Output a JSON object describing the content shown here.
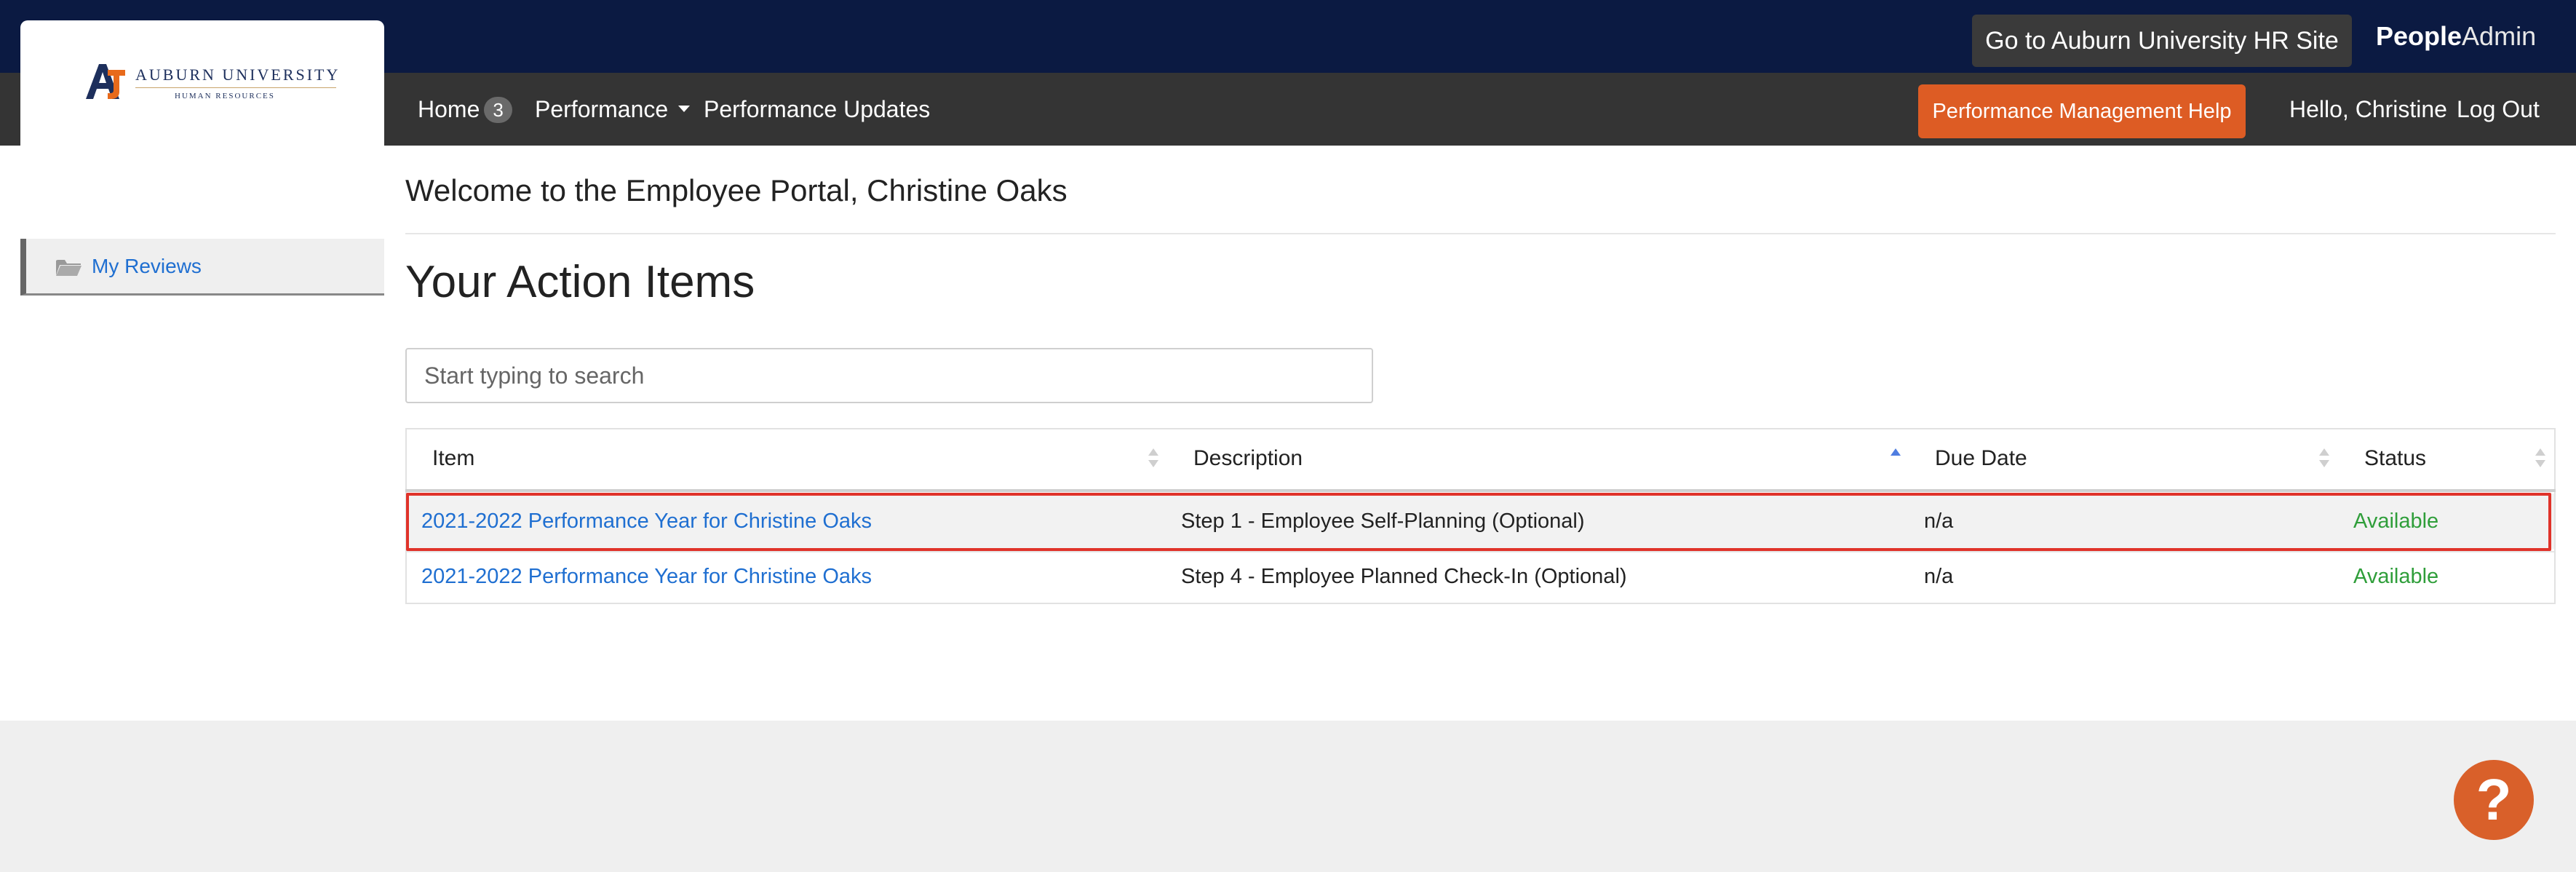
{
  "header": {
    "hr_site_button": "Go to Auburn University HR Site",
    "brand_bold": "People",
    "brand_light": "Admin"
  },
  "logo": {
    "main": "AUBURN UNIVERSITY",
    "sub": "HUMAN RESOURCES"
  },
  "nav": {
    "home": "Home",
    "home_badge": "3",
    "performance": "Performance",
    "performance_updates": "Performance Updates",
    "help_button": "Performance Management Help",
    "greeting": "Hello, Christine",
    "logout": "Log Out"
  },
  "sidebar": {
    "items": [
      {
        "label": "My Reviews",
        "icon": "folder-open-icon"
      }
    ]
  },
  "main": {
    "welcome": "Welcome to the Employee Portal, Christine Oaks",
    "title": "Your Action Items",
    "search_placeholder": "Start typing to search",
    "table": {
      "columns": [
        "Item",
        "Description",
        "Due Date",
        "Status"
      ],
      "sorted_column": "Description",
      "rows": [
        {
          "item": "2021-2022 Performance Year for Christine Oaks",
          "description": "Step 1 - Employee Self-Planning (Optional)",
          "due": "n/a",
          "status": "Available",
          "highlighted": true
        },
        {
          "item": "2021-2022 Performance Year for Christine Oaks",
          "description": "Step 4 - Employee Planned Check-In (Optional)",
          "due": "n/a",
          "status": "Available",
          "highlighted": false
        }
      ]
    }
  },
  "help_fab": "?",
  "colors": {
    "topbar": "#0b1a42",
    "navbar": "#343434",
    "accent_orange": "#dd5c24",
    "link_blue": "#1f6fd1",
    "status_green": "#2f9e3a",
    "highlight_red": "#e0332a"
  }
}
